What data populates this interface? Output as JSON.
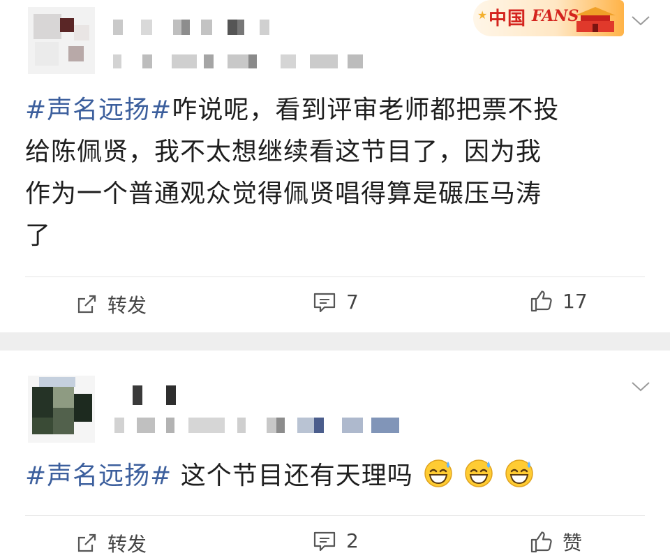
{
  "posts": [
    {
      "hashtag": "#声名远扬#",
      "text": "咋说呢，看到评审老师都把票不投给陈佩贤，我不太想继续看这节目了，因为我作为一个普通观众觉得佩贤唱得算是碾压马涛了",
      "lines": [
        "咋说呢，看到评审老师都把票不投",
        "给陈佩贤，我不太想继续看这节目了，因为我",
        "作为一个普通观众觉得佩贤唱得算是碾压马涛",
        "了"
      ],
      "badge": {
        "cn": "中国",
        "fans": "FANS"
      },
      "actions": {
        "repost_label": "转发",
        "comment_count": "7",
        "like_count": "17"
      }
    },
    {
      "hashtag": "#声名远扬#",
      "text": " 这个节目还有天理吗",
      "emoji": [
        "grinning-sweat-emoji",
        "grinning-sweat-emoji",
        "grinning-sweat-emoji"
      ],
      "actions": {
        "repost_label": "转发",
        "comment_count": "2",
        "like_label": "赞"
      }
    }
  ],
  "colors": {
    "hashtag": "#3c5f9d",
    "separator": "#eeeeee",
    "icon": "#555555"
  }
}
